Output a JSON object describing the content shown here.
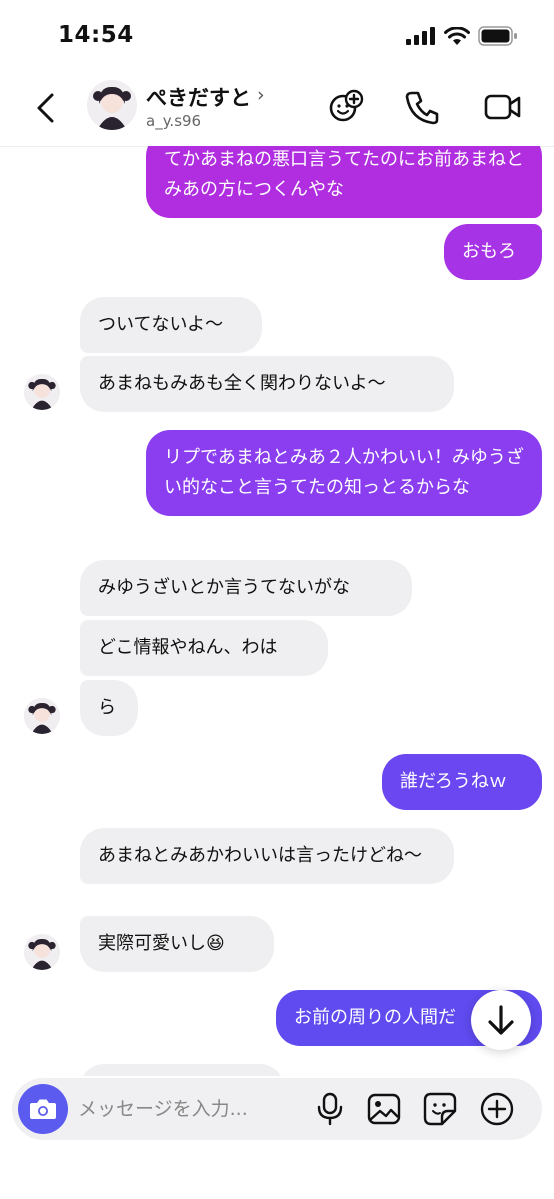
{
  "status": {
    "time": "14:54"
  },
  "header": {
    "name": "ぺきだすと",
    "chevron": "›",
    "handle": "a_y.s96"
  },
  "messages": [
    {
      "dir": "out",
      "text": "てかあまねの悪口言うてたのにお前あまねとみあの方につくんやな"
    },
    {
      "dir": "out",
      "text": "おもろ"
    },
    {
      "dir": "in",
      "text": "ついてないよ〜"
    },
    {
      "dir": "in",
      "text": "あまねもみあも全く関わりないよ〜"
    },
    {
      "dir": "out",
      "text": "リプであまねとみあ２人かわいい！みゆうざい的なこと言うてたの知っとるからな"
    },
    {
      "dir": "in",
      "text": "みゆうざいとか言うてないがな"
    },
    {
      "dir": "in",
      "text": "どこ情報やねん、わは"
    },
    {
      "dir": "in",
      "text": "ら"
    },
    {
      "dir": "out",
      "text": "誰だろうねｗ"
    },
    {
      "dir": "in",
      "text": "あまねとみあかわいいは言ったけどね〜"
    },
    {
      "dir": "in",
      "text": "実際可愛いし😆"
    },
    {
      "dir": "out",
      "text": "お前の周りの人間だ"
    }
  ],
  "composer": {
    "placeholder": "メッセージを入力..."
  },
  "colors": {
    "bubble_pink": "#b02ee0",
    "bubble_violet": "#8a3ef0",
    "bubble_blue": "#5f4bf0",
    "incoming": "#efeff1",
    "camera": "#5b5bf0"
  },
  "icons": [
    "back-arrow-icon",
    "sticker-add-icon",
    "phone-icon",
    "video-camera-icon",
    "camera-icon",
    "microphone-icon",
    "gallery-icon",
    "sticker-icon",
    "plus-circle-icon",
    "arrow-down-icon"
  ]
}
